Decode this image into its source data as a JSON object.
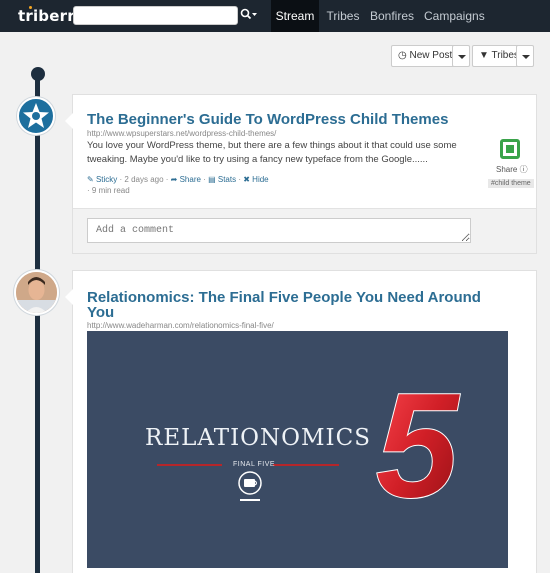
{
  "nav": {
    "logo": "triberr",
    "search": {
      "value": "",
      "placeholder": ""
    },
    "tabs": [
      {
        "label": "Stream",
        "active": true
      },
      {
        "label": "Tribes",
        "active": false
      },
      {
        "label": "Bonfires",
        "active": false
      },
      {
        "label": "Campaigns",
        "active": false
      }
    ]
  },
  "toolbar": {
    "new_posts_label": "New Posts",
    "tribes_label": "Tribes"
  },
  "posts": [
    {
      "title": "The Beginner's Guide To WordPress Child Themes",
      "url": "http://www.wpsuperstars.net/wordpress-child-themes/",
      "excerpt": "You love your WordPress theme, but there are a few things about it that could use some tweaking. Maybe you'd like to try using a fancy new typeface from the Google......",
      "meta": {
        "sticky": "Sticky",
        "age": "2 days ago",
        "share": "Share",
        "stats": "Stats",
        "hide": "Hide",
        "read_time": "9 min read"
      },
      "share_widget_label": "Share",
      "hashtag": "#child theme",
      "comment": {
        "value": "",
        "placeholder": "Add a comment"
      }
    },
    {
      "title": "Relationomics: The Final Five People You Need Around You",
      "url": "http://www.wadeharman.com/relationomics-final-five/",
      "image": {
        "title": "RELATIONOMICS",
        "subtitle": "FINAL FIVE",
        "big_number": "5"
      }
    }
  ],
  "colors": {
    "navbar": "#1d2630",
    "accent_blue": "#2c6d93",
    "timeline": "#1d2e3f",
    "share_green": "#3aa34a",
    "image_bg": "#3b4b64",
    "image_red": "#d11f27"
  }
}
